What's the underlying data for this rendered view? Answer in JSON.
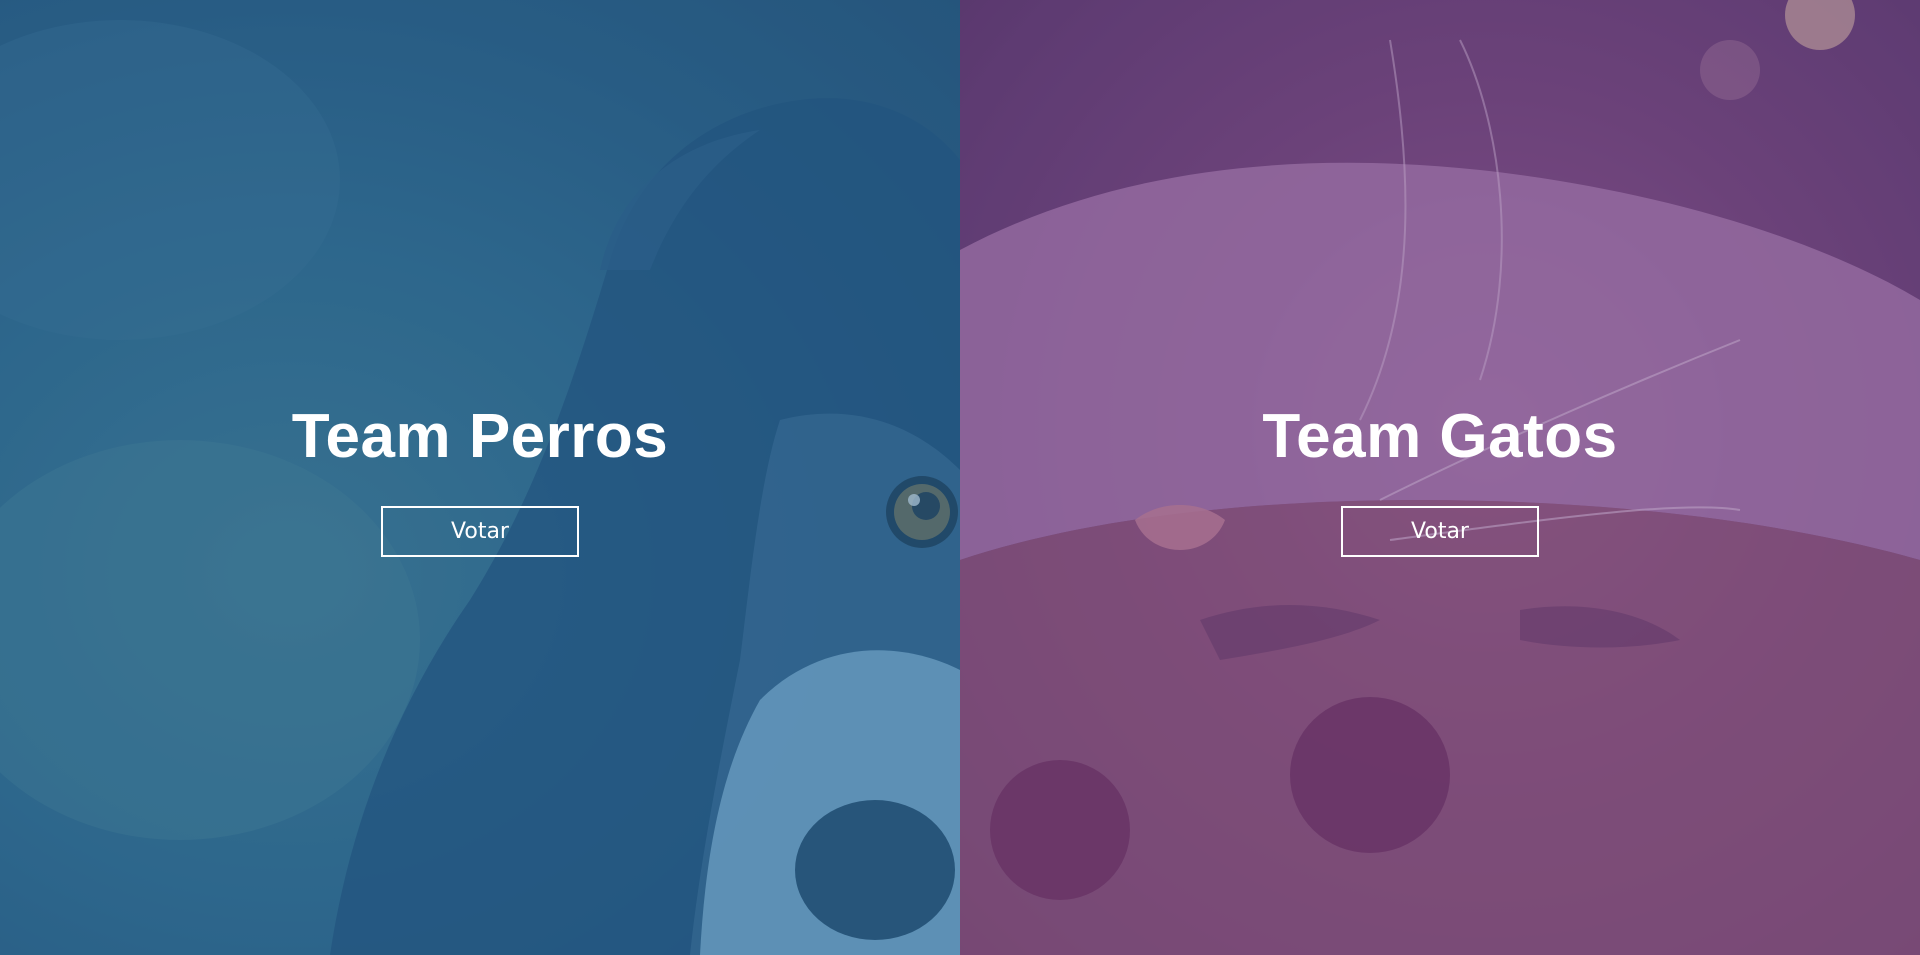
{
  "dogs": {
    "title": "Team Perros",
    "button_label": "Votar",
    "tint_color": "#2b608c"
  },
  "cats": {
    "title": "Team Gatos",
    "button_label": "Votar",
    "tint_color": "#683e7c"
  }
}
